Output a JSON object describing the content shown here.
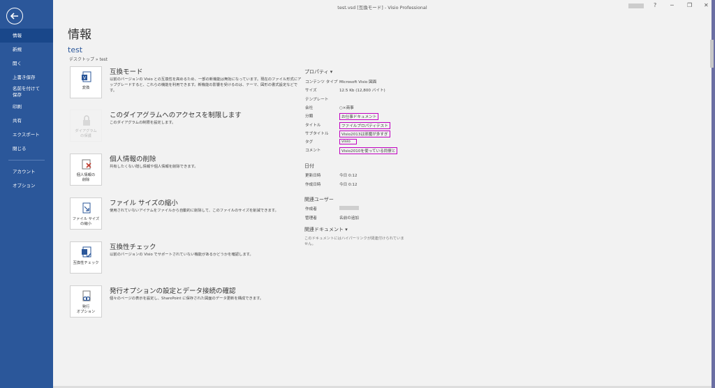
{
  "window": {
    "title": "test.vsd  [互換モード] - Visio Professional",
    "help": "?",
    "minimize": "─",
    "restore": "❐",
    "close": "✕"
  },
  "sidebar": {
    "items": [
      {
        "label": "情報",
        "active": true
      },
      {
        "label": "新規"
      },
      {
        "label": "開く"
      },
      {
        "label": "上書き保存"
      },
      {
        "label": "名前を付けて\n保存"
      },
      {
        "label": "印刷"
      },
      {
        "label": "共有"
      },
      {
        "label": "エクスポート"
      },
      {
        "label": "閉じる"
      },
      {
        "label": "アカウント"
      },
      {
        "label": "オプション"
      }
    ]
  },
  "main": {
    "page_title": "情報",
    "doc_title": "test",
    "doc_path": "デスクトップ » test",
    "actions": [
      {
        "icon": "convert-icon",
        "btn": "変換",
        "title": "互換モード",
        "desc": "以前のバージョンの Visio との互換性を高めるため、一部の新機能は無効になっています。現在のファイル形式にアップグレードすると、これらの機能を利用できます。新機能の影響を受けるのは、テーマ、図形の書式設定などです。"
      },
      {
        "icon": "lock-icon",
        "btn": "ダイアグラム\nの保護",
        "title": "このダイアグラムへのアクセスを制限します",
        "desc": "このダイアグラムの制限を設定します。"
      },
      {
        "icon": "remove-personal-info-icon",
        "btn": "個人情報の\n削除",
        "title": "個人情報の削除",
        "desc": "共有したくない隠し情報や個人情報を削除できます。"
      },
      {
        "icon": "reduce-file-size-icon",
        "btn": "ファイル サイズ\nの縮小",
        "title": "ファイル サイズの縮小",
        "desc": "使用されていないアイテムをファイルから自動的に削除して、このファイルのサイズを削減できます。"
      },
      {
        "icon": "compatibility-check-icon",
        "btn": "互換性チェック",
        "title": "互換性チェック",
        "desc": "以前のバージョンの Visio でサポートされていない機能があるかどうかを確認します。"
      },
      {
        "icon": "publish-options-icon",
        "btn": "発行\nオプション",
        "title": "発行オプションの設定とデータ接続の確認",
        "desc": "個々のページの表示を設定し、SharePoint に保存された図面のデータ更新を構成できます。"
      }
    ]
  },
  "properties": {
    "heading": "プロパティ ▾",
    "rows": [
      {
        "k": "コンテンツ タイプ",
        "v": "Microsoft Visio 図面"
      },
      {
        "k": "サイズ",
        "v": "12.5 Kb (12,800 バイト)"
      },
      {
        "k": "テンプレート",
        "v": ""
      },
      {
        "k": "会社",
        "v": "○×商事"
      },
      {
        "k": "分類",
        "v": "お仕事ドキュメント",
        "boxed": true
      },
      {
        "k": "タイトル",
        "v": "ファイルプロパティテスト",
        "boxed": true
      },
      {
        "k": "サブタイトル",
        "v": "Visio2013は邪魔が多すぎ",
        "boxed": true
      },
      {
        "k": "タグ",
        "v": "visio",
        "boxed": true
      },
      {
        "k": "コメント",
        "v": "Visio2010を使っている同僚と",
        "boxed": true
      }
    ]
  },
  "dates": {
    "heading": "日付",
    "rows": [
      {
        "k": "更新日時",
        "v": "今日 0:12"
      },
      {
        "k": "作成日時",
        "v": "今日 0:12"
      }
    ]
  },
  "users": {
    "heading": "関連ユーザー",
    "rows": [
      {
        "k": "作成者",
        "v": ""
      },
      {
        "k": "管理者",
        "v": "名前の追加"
      }
    ]
  },
  "docs": {
    "heading": "関連ドキュメント ▾",
    "note": "このドキュメントにはハイパーリンクが関連付けられていません。"
  }
}
